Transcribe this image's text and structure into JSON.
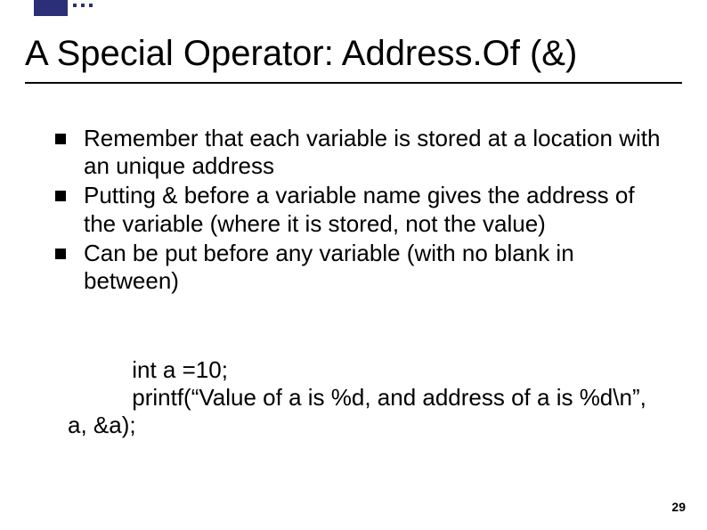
{
  "slide": {
    "title": "A Special Operator: Address.Of (&)",
    "bullets": [
      "Remember that each variable is stored at a location with an unique address",
      "Putting & before a variable name gives the address of the variable (where it is stored, not the value)",
      "Can be put before any variable (with no blank in between)"
    ],
    "code": "          int a =10;\n          printf(“Value of a is %d, and address of a is %d\\n”, a, &a);",
    "page_number": "29"
  }
}
